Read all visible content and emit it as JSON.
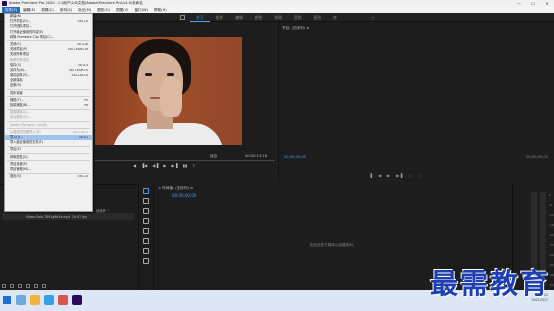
{
  "window": {
    "title": "Adobe Premiere Pro 2020 - C:\\用户\\Lili\\文档\\Adobe\\Premiere Pro\\14.0\\未命名",
    "minimize": "—",
    "maximize": "☐",
    "close": "✕"
  },
  "menubar": {
    "items": [
      "文件(F)",
      "编辑(E)",
      "剪辑(C)",
      "序列(S)",
      "标记(M)",
      "图形(G)",
      "视图(V)",
      "窗口(W)",
      "帮助(H)"
    ]
  },
  "workspaces": {
    "tabs": [
      "学习",
      "组件",
      "编辑",
      "颜色",
      "效果",
      "音频",
      "图形",
      "库"
    ],
    "active": "学习",
    "more": "»"
  },
  "file_menu": {
    "items": [
      {
        "label": "新建(N)",
        "shortcut": "",
        "disabled": false
      },
      {
        "label": "打开项目(O)...",
        "shortcut": "Ctrl+O",
        "disabled": false
      },
      {
        "label": "打开团队项目...",
        "shortcut": "",
        "disabled": false
      },
      {
        "label": "打开最近使用的内容(E)",
        "shortcut": "",
        "disabled": false
      },
      {
        "label": "转换 Premiere Clip 项目(C)...",
        "shortcut": "",
        "disabled": false
      },
      {
        "sep": true
      },
      {
        "label": "关闭(C)",
        "shortcut": "Ctrl+W",
        "disabled": false
      },
      {
        "label": "关闭项目(P)",
        "shortcut": "Ctrl+Shift+W",
        "disabled": false
      },
      {
        "label": "关闭所有项目",
        "shortcut": "",
        "disabled": false
      },
      {
        "label": "刷新所有项目",
        "shortcut": "",
        "disabled": true
      },
      {
        "label": "保存(S)",
        "shortcut": "Ctrl+S",
        "disabled": false
      },
      {
        "label": "另存为(A)...",
        "shortcut": "Ctrl+Shift+S",
        "disabled": false
      },
      {
        "label": "保存副本(Y)...",
        "shortcut": "Ctrl+Alt+S",
        "disabled": false
      },
      {
        "label": "全部保存",
        "shortcut": "",
        "disabled": false
      },
      {
        "label": "还原(R)",
        "shortcut": "",
        "disabled": false
      },
      {
        "sep": true
      },
      {
        "label": "同步设置",
        "shortcut": "",
        "disabled": false
      },
      {
        "sep": true
      },
      {
        "label": "捕捉(T)...",
        "shortcut": "F5",
        "disabled": false
      },
      {
        "label": "批量捕捉(B)...",
        "shortcut": "F6",
        "disabled": false
      },
      {
        "sep": true
      },
      {
        "label": "链接媒体(L)...",
        "shortcut": "",
        "disabled": true
      },
      {
        "label": "设为脱机(O)...",
        "shortcut": "",
        "disabled": true
      },
      {
        "sep": true
      },
      {
        "label": "Adobe Dynamic Link(K)",
        "shortcut": "",
        "disabled": true
      },
      {
        "sep": true
      },
      {
        "label": "从媒体浏览器导入(M)",
        "shortcut": "Ctrl+Alt+I",
        "disabled": true
      },
      {
        "label": "导入(I)...",
        "shortcut": "Ctrl+I",
        "disabled": false,
        "highlight": true
      },
      {
        "label": "导入最近使用的文件(F)",
        "shortcut": "",
        "disabled": false
      },
      {
        "sep": true
      },
      {
        "label": "导出(E)",
        "shortcut": "",
        "disabled": false
      },
      {
        "sep": true
      },
      {
        "label": "获取属性(G)",
        "shortcut": "",
        "disabled": false
      },
      {
        "sep": true
      },
      {
        "label": "项目设置(P)",
        "shortcut": "",
        "disabled": false
      },
      {
        "label": "项目管理(M)...",
        "shortcut": "",
        "disabled": false
      },
      {
        "sep": true
      },
      {
        "label": "退出(X)",
        "shortcut": "Ctrl+Q",
        "disabled": false
      }
    ]
  },
  "source_monitor": {
    "fit": "适合",
    "timecode": "00:00:13:16",
    "controls": [
      "◀",
      "▐◀",
      "◀▐",
      "▶",
      "▶▐",
      "▮▮",
      "⇪"
    ]
  },
  "program_monitor": {
    "header": "节目: (无序列) ≡",
    "timecode_left": "00;00;00;00",
    "timecode_right": "00;00;00;00",
    "controls": [
      "▐",
      "◀",
      "▶",
      "▶▐",
      "⬚",
      "⬚"
    ]
  },
  "project_panel": {
    "column_header": "帧速率 ^",
    "file_name": "Video-Sala-7891g9b3a.mp4",
    "fps": "29.97 fps"
  },
  "timeline": {
    "header": "× 时间轴: (无序列) ≡",
    "timecode": "00;00;00;00",
    "empty_message": "在此处放下媒体以创建序列。"
  },
  "audio_meter": {
    "scale": [
      "0",
      "-6",
      "-12",
      "-18",
      "-24",
      "-30",
      "-36",
      "-42",
      "-48",
      "-54",
      "dB"
    ]
  },
  "taskbar": {
    "time": "11:01",
    "date": "2021/5/17"
  },
  "watermark": "最需教育"
}
